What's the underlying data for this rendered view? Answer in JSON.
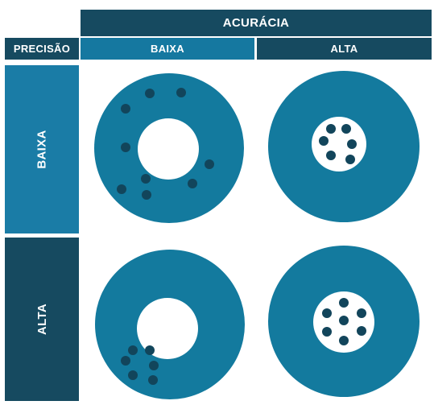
{
  "header": {
    "accuracy": "ACURÁCIA",
    "precision": "PRECISÃO"
  },
  "columns": {
    "low": "BAIXA",
    "high": "ALTA"
  },
  "rows": {
    "low": "BAIXA",
    "high": "ALTA"
  },
  "colors": {
    "dark_navy": "#164a60",
    "medium_blue": "#1a7ca6",
    "target_ring": "#137a9e",
    "hole": "#ffffff",
    "dot": "#12455b"
  },
  "targets": [
    {
      "name": "target-low-accuracy-low-precision",
      "dots": 10
    },
    {
      "name": "target-high-accuracy-low-precision",
      "dots": 6
    },
    {
      "name": "target-low-accuracy-high-precision",
      "dots": 7
    },
    {
      "name": "target-high-accuracy-high-precision",
      "dots": 8
    }
  ]
}
